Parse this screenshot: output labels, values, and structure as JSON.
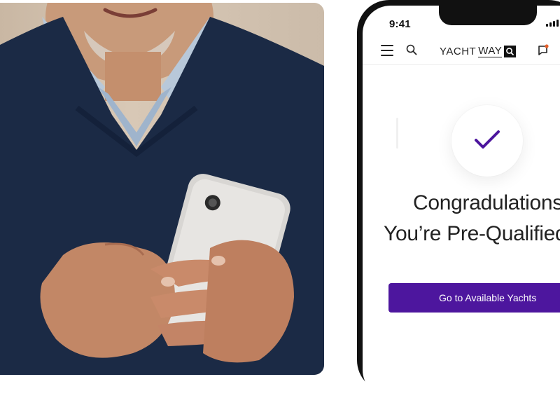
{
  "phone": {
    "status_time": "9:41",
    "header": {
      "logo_text_yacht": "YACHT",
      "logo_text_way": "WAY"
    },
    "confirmation": {
      "line1": "Congradulations,",
      "line2": "You’re Pre-Qualified"
    },
    "cta_label": "Go to Available Yachts"
  },
  "colors": {
    "accent": "#4d169e",
    "sweater": "#1b2a45"
  },
  "icons": [
    "menu-icon",
    "search-icon",
    "chat-icon",
    "check-icon",
    "signal-icon"
  ]
}
